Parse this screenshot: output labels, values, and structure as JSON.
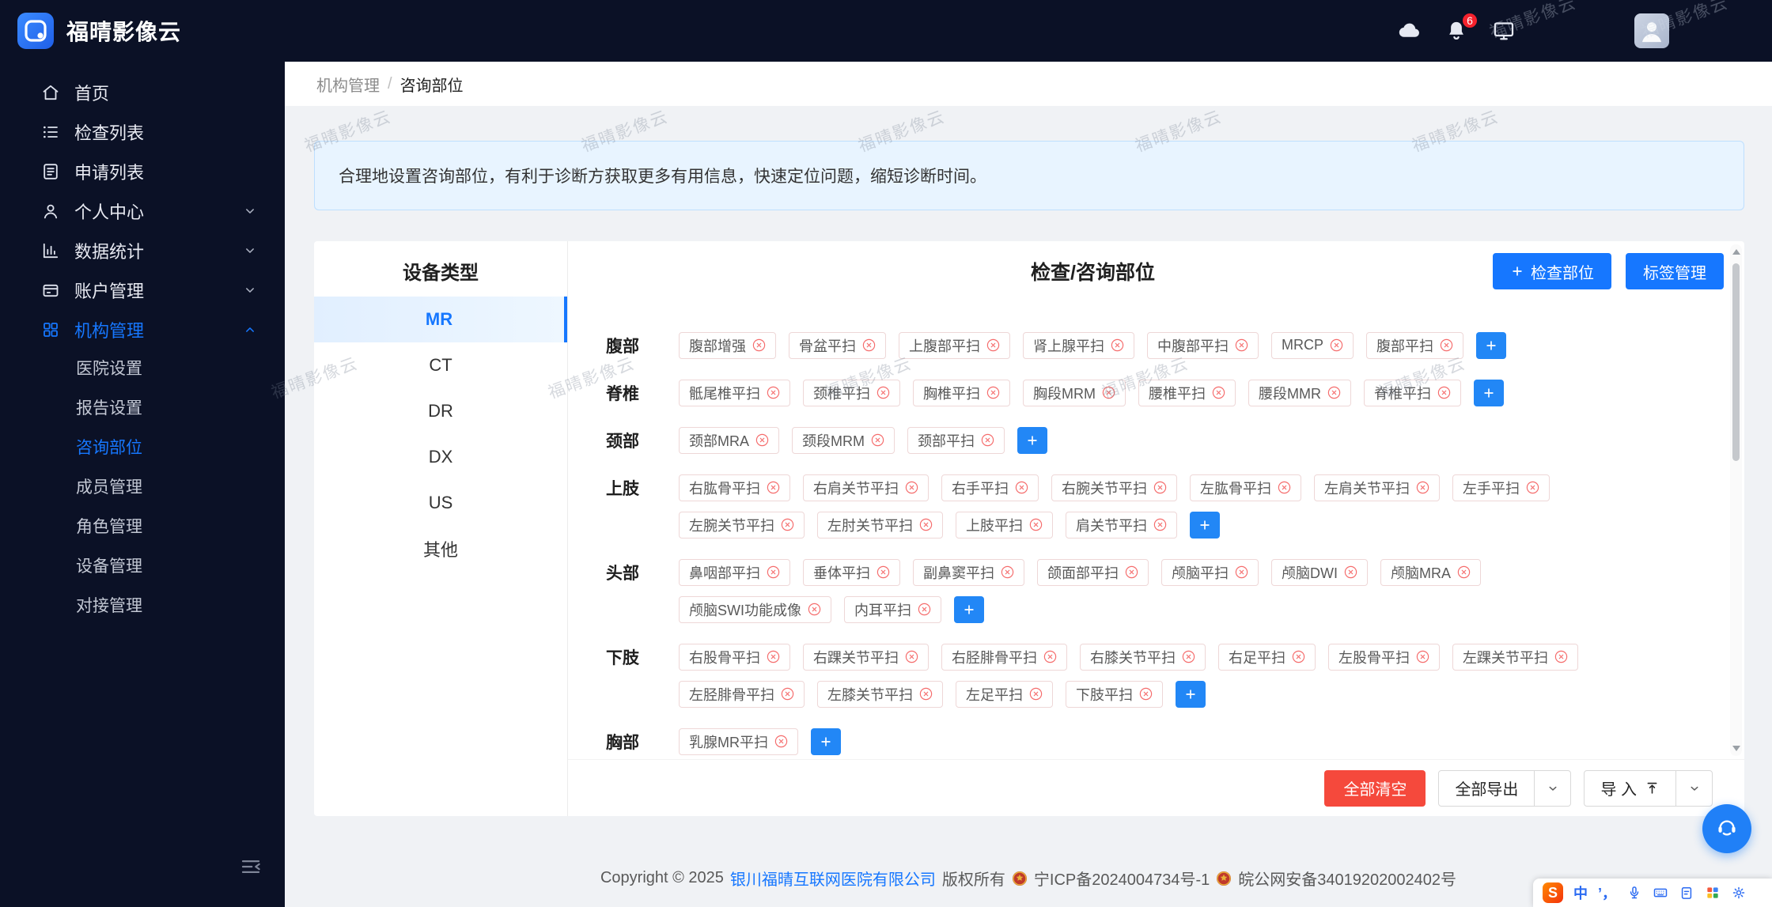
{
  "app": {
    "title": "福晴影像云"
  },
  "header": {
    "notification_badge": "6"
  },
  "watermark": {
    "text": "福晴影像云"
  },
  "sidebar": {
    "items": [
      {
        "label": "首页",
        "icon": "home-icon"
      },
      {
        "label": "检查列表",
        "icon": "list-icon"
      },
      {
        "label": "申请列表",
        "icon": "form-icon"
      },
      {
        "label": "个人中心",
        "icon": "user-icon",
        "chevron": "down"
      },
      {
        "label": "数据统计",
        "icon": "chart-icon",
        "chevron": "down"
      },
      {
        "label": "账户管理",
        "icon": "wallet-icon",
        "chevron": "down"
      },
      {
        "label": "机构管理",
        "icon": "org-icon",
        "chevron": "up",
        "active": true
      }
    ],
    "submenu": [
      {
        "label": "医院设置"
      },
      {
        "label": "报告设置"
      },
      {
        "label": "咨询部位",
        "active": true
      },
      {
        "label": "成员管理"
      },
      {
        "label": "角色管理"
      },
      {
        "label": "设备管理"
      },
      {
        "label": "对接管理"
      }
    ]
  },
  "breadcrumb": {
    "parent": "机构管理",
    "separator": "/",
    "current": "咨询部位"
  },
  "banner": {
    "text": "合理地设置咨询部位，有利于诊断方获取更多有用信息，快速定位问题，缩短诊断时间。"
  },
  "panel": {
    "device_header": "设备类型",
    "devices": [
      {
        "label": "MR",
        "active": true
      },
      {
        "label": "CT"
      },
      {
        "label": "DR"
      },
      {
        "label": "DX"
      },
      {
        "label": "US"
      },
      {
        "label": "其他"
      }
    ],
    "parts_header": "检查/咨询部位",
    "add_part_button": "检查部位",
    "tag_manage_button": "标签管理",
    "rows": [
      {
        "label": "腹部",
        "lines": [
          [
            "腹部增强",
            "骨盆平扫",
            "上腹部平扫",
            "肾上腺平扫",
            "中腹部平扫",
            "MRCP",
            "腹部平扫"
          ]
        ]
      },
      {
        "label": "脊椎",
        "lines": [
          [
            "骶尾椎平扫",
            "颈椎平扫",
            "胸椎平扫",
            "胸段MRM",
            "腰椎平扫",
            "腰段MMR",
            "脊椎平扫"
          ]
        ]
      },
      {
        "label": "颈部",
        "lines": [
          [
            "颈部MRA",
            "颈段MRM",
            "颈部平扫"
          ]
        ]
      },
      {
        "label": "上肢",
        "lines": [
          [
            "右肱骨平扫",
            "右肩关节平扫",
            "右手平扫",
            "右腕关节平扫",
            "左肱骨平扫",
            "左肩关节平扫",
            "左手平扫"
          ],
          [
            "左腕关节平扫",
            "左肘关节平扫",
            "上肢平扫",
            "肩关节平扫"
          ]
        ]
      },
      {
        "label": "头部",
        "lines": [
          [
            "鼻咽部平扫",
            "垂体平扫",
            "副鼻窦平扫",
            "颌面部平扫",
            "颅脑平扫",
            "颅脑DWI",
            "颅脑MRA"
          ],
          [
            "颅脑SWI功能成像",
            "内耳平扫"
          ]
        ]
      },
      {
        "label": "下肢",
        "lines": [
          [
            "右股骨平扫",
            "右踝关节平扫",
            "右胫腓骨平扫",
            "右膝关节平扫",
            "右足平扫",
            "左股骨平扫",
            "左踝关节平扫"
          ],
          [
            "左胫腓骨平扫",
            "左膝关节平扫",
            "左足平扫",
            "下肢平扫"
          ]
        ]
      },
      {
        "label": "胸部",
        "lines": [
          [
            "乳腺MR平扫"
          ]
        ]
      }
    ],
    "clear_all": "全部清空",
    "export_all": "全部导出",
    "import_label": "导 入"
  },
  "page_footer": {
    "prefix": "Copyright © 2025",
    "company": "银川福晴互联网医院有限公司",
    "rights": "版权所有",
    "icp": "宁ICP备2024004734号-1",
    "police": "皖公网安备34019202002402号"
  },
  "ime": {
    "logo_letter": "S",
    "mode_label": "中",
    "punct_label": "’，"
  }
}
